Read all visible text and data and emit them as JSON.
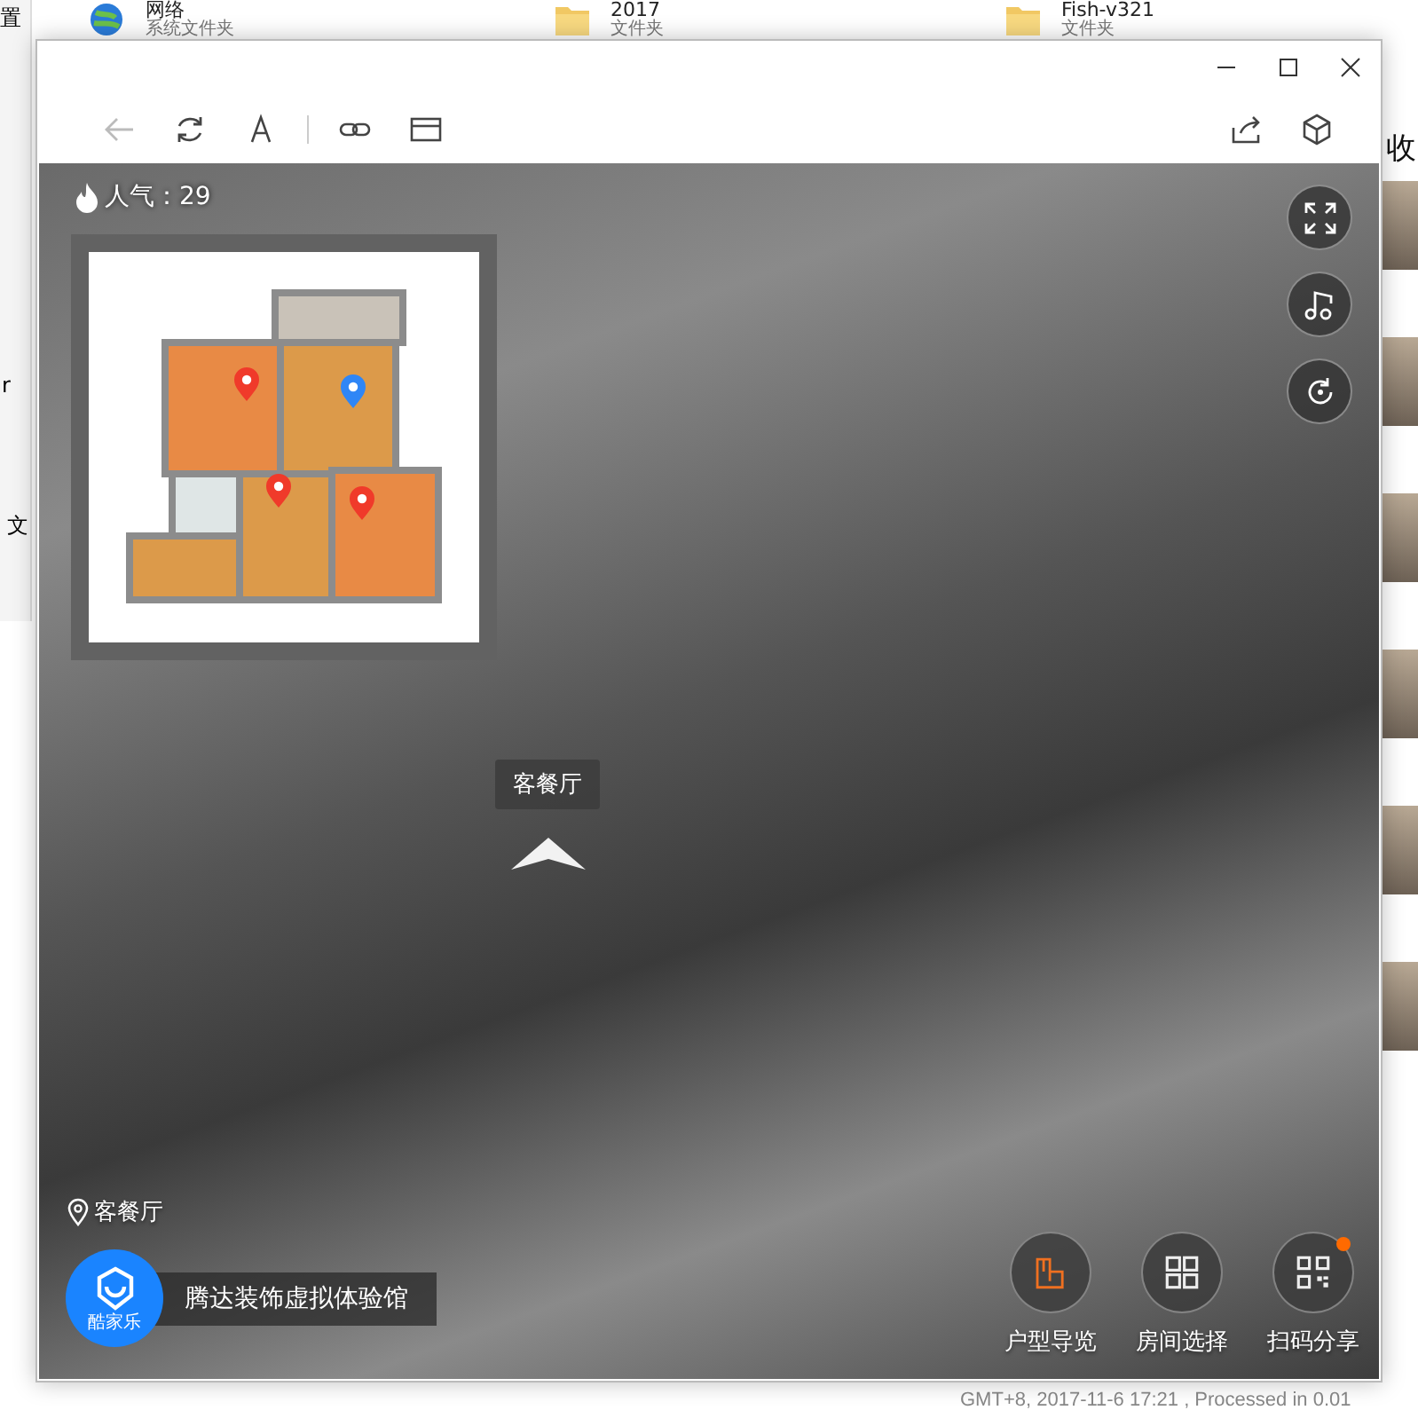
{
  "desktop": {
    "files": [
      {
        "name": "网络",
        "type": "系统文件夹",
        "kind": "network"
      },
      {
        "name": "2017",
        "type": "文件夹",
        "kind": "folder"
      },
      {
        "name": "Fish-v321",
        "type": "文件夹",
        "kind": "folder"
      }
    ],
    "left_fragments": [
      "置",
      "r",
      "文"
    ],
    "right_heading": "收",
    "footer": "GMT+8, 2017-11-6 17:21 , Processed in 0.01"
  },
  "toolbar": {
    "back_disabled": true
  },
  "panorama": {
    "popularity": "人气：29",
    "floor_plan": {
      "pins": [
        {
          "selected": false
        },
        {
          "selected": true
        },
        {
          "selected": false
        },
        {
          "selected": false
        }
      ]
    },
    "hotspot": "客餐厅",
    "location": "客餐厅",
    "logo_text": "酷家乐",
    "brand": "腾达装饰虚拟体验馆",
    "actions": [
      {
        "label": "户型导览",
        "kind": "floorplan",
        "notification": false
      },
      {
        "label": "房间选择",
        "kind": "rooms",
        "notification": false
      },
      {
        "label": "扫码分享",
        "kind": "qr",
        "notification": true
      }
    ]
  }
}
